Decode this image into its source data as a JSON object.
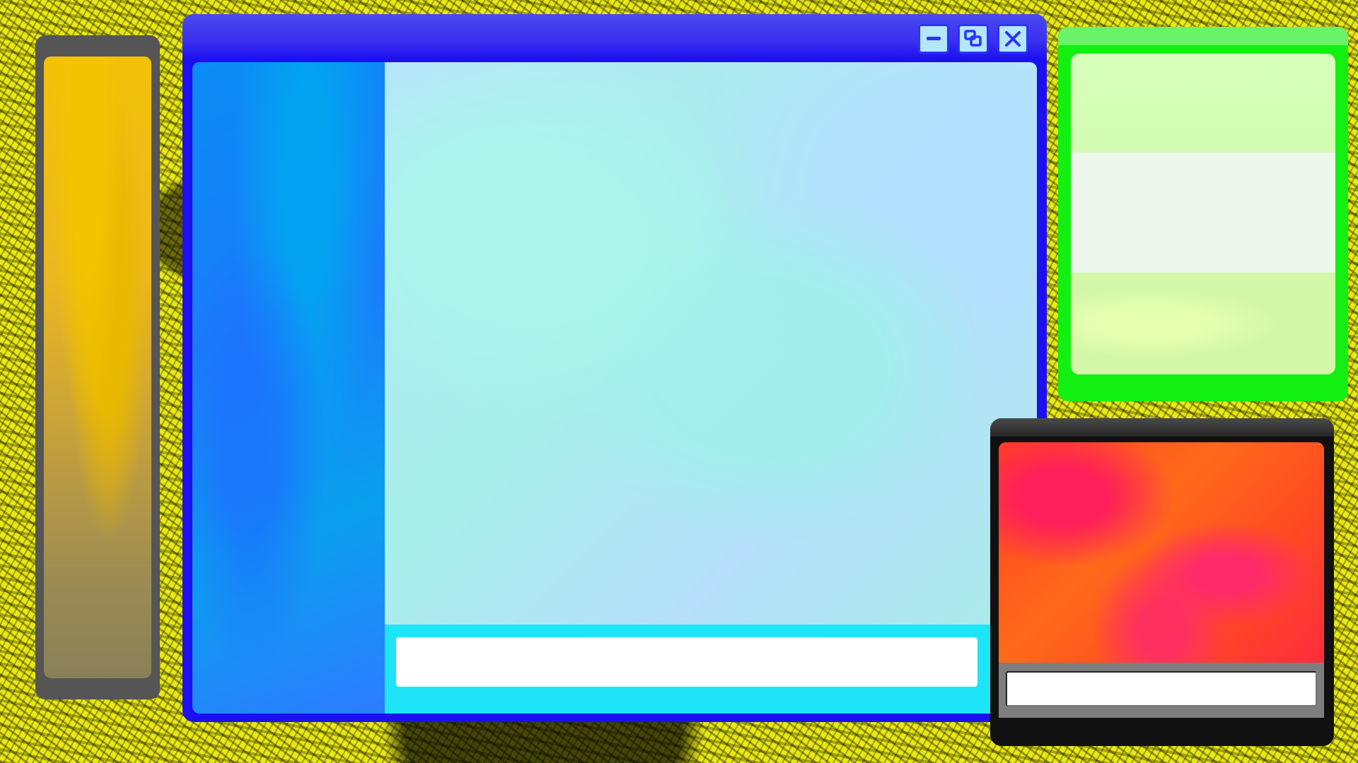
{
  "desktop": {
    "background_color": "#e8e815",
    "texture": "yellow-black-grunge"
  },
  "windows": {
    "left_panel": {
      "frame_color": "#555555",
      "content": "orange-yellow-marble"
    },
    "main": {
      "frame_color": "#1c10f0",
      "controls": {
        "minimize_icon": "minimize-icon",
        "restore_icon": "restore-icon",
        "close_icon": "close-icon"
      },
      "sidebar_color": "#0b8cf5",
      "pane_color": "#b8e4fb",
      "input": {
        "value": "",
        "placeholder": ""
      }
    },
    "green": {
      "frame_color": "#12f012",
      "content": "light-green-marble"
    },
    "red": {
      "frame_color": "#111111",
      "content": "red-orange-marble",
      "input": {
        "value": "",
        "placeholder": ""
      }
    }
  }
}
